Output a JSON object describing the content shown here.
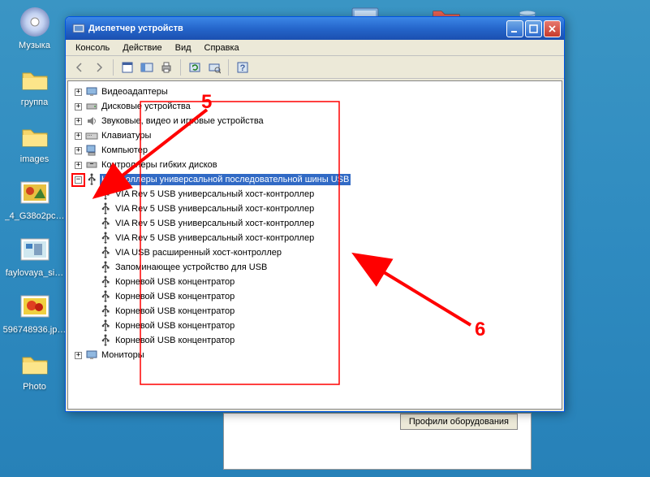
{
  "desktop": {
    "icons": [
      {
        "label": "Музыка",
        "type": "cd"
      },
      {
        "label": "группа",
        "type": "folder"
      },
      {
        "label": "images",
        "type": "folder"
      },
      {
        "label": "_4_G38o2pc…",
        "type": "image"
      },
      {
        "label": "faylovaya_si…",
        "type": "image"
      },
      {
        "label": "596748936.jp…",
        "type": "image"
      },
      {
        "label": "Photo",
        "type": "folder"
      }
    ],
    "top_icons": [
      {
        "name": "monitor-icon"
      },
      {
        "name": "folder-red-icon"
      },
      {
        "name": "recycle-bin-icon"
      }
    ]
  },
  "window": {
    "title": "Диспетчер устройств",
    "menu": [
      "Консоль",
      "Действие",
      "Вид",
      "Справка"
    ],
    "tree": {
      "level1": [
        {
          "label": "Видеоадаптеры",
          "icon": "display"
        },
        {
          "label": "Дисковые устройства",
          "icon": "disk"
        },
        {
          "label": "Звуковые, видео и игровые устройства",
          "icon": "sound"
        },
        {
          "label": "Клавиатуры",
          "icon": "keyboard"
        },
        {
          "label": "Компьютер",
          "icon": "computer"
        },
        {
          "label": "Контроллеры гибких дисков",
          "icon": "floppy"
        }
      ],
      "expanded": {
        "label": "Контроллеры универсальной последовательной шины USB",
        "icon": "usb",
        "children": [
          "VIA Rev 5 USB универсальный хост-контроллер",
          "VIA Rev 5 USB универсальный хост-контроллер",
          "VIA Rev 5 USB универсальный хост-контроллер",
          "VIA Rev 5 USB универсальный хост-контроллер",
          "VIA USB расширенный хост-контроллер",
          "Запоминающее устройство для USB",
          "Корневой USB концентратор",
          "Корневой USB концентратор",
          "Корневой USB концентратор",
          "Корневой USB концентратор",
          "Корневой USB концентратор"
        ]
      },
      "after": [
        {
          "label": "Мониторы",
          "icon": "monitor"
        }
      ]
    }
  },
  "aux": {
    "button": "Профили оборудования"
  },
  "annotations": {
    "a5": "5",
    "a6": "6"
  }
}
